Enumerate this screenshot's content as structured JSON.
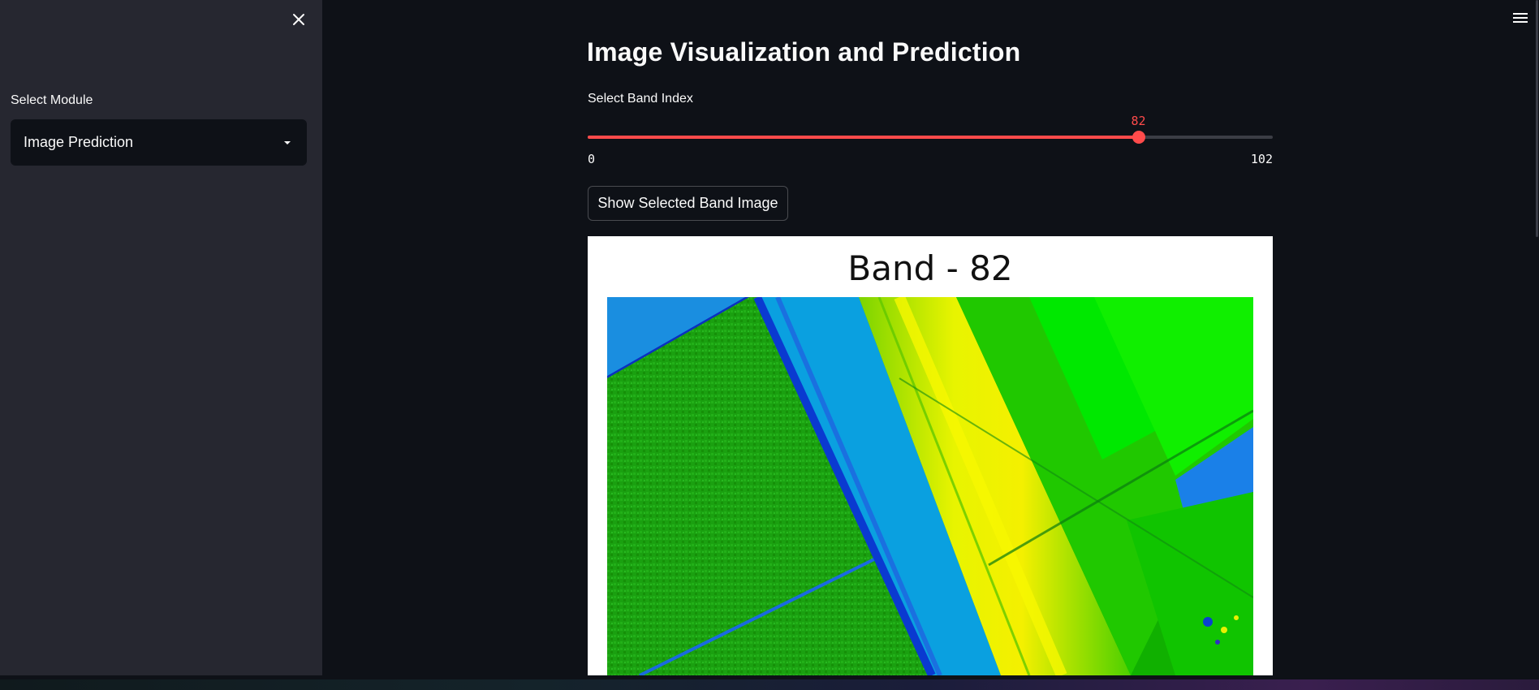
{
  "sidebar": {
    "close_icon": "close-icon",
    "select_label": "Select Module",
    "select_value": "Image Prediction",
    "select_icon": "caret-down-icon"
  },
  "header": {
    "menu_icon": "hamburger-menu-icon"
  },
  "main": {
    "title": "Image Visualization and Prediction",
    "slider": {
      "label": "Select Band Index",
      "value": 82,
      "value_text": "82",
      "min": 0,
      "max": 102,
      "min_text": "0",
      "max_text": "102",
      "accent_color": "#ff4b4b"
    },
    "button_label": "Show Selected Band Image",
    "figure": {
      "title": "Band - 82",
      "image_description_colors": [
        "#00c000",
        "#00a0e0",
        "#0040e0",
        "#e0f000",
        "#00ff00"
      ]
    }
  },
  "theme": {
    "background": "#0e1117",
    "sidebar_background": "#262730",
    "text": "#fafafa"
  }
}
